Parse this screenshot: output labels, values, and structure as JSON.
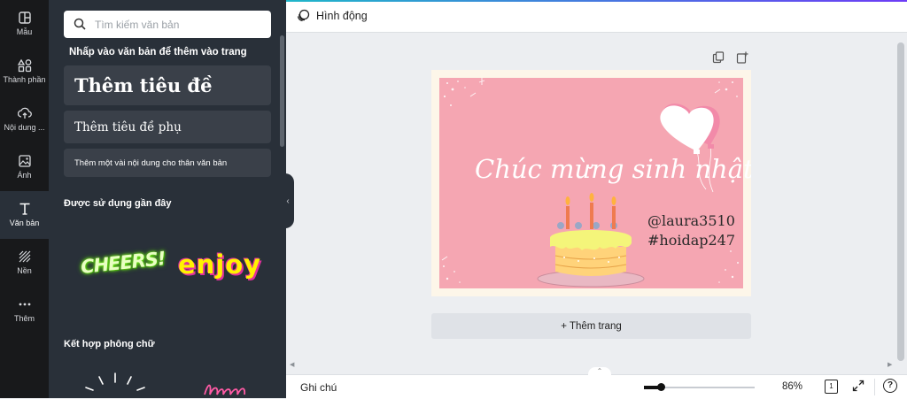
{
  "sidebar": {
    "items": [
      {
        "label": "Mẫu",
        "icon": "template-icon"
      },
      {
        "label": "Thành phần",
        "icon": "elements-icon"
      },
      {
        "label": "Nội dung ...",
        "icon": "upload-icon"
      },
      {
        "label": "Ảnh",
        "icon": "photo-icon"
      },
      {
        "label": "Văn bản",
        "icon": "text-icon"
      },
      {
        "label": "Nền",
        "icon": "background-icon"
      },
      {
        "label": "Thêm",
        "icon": "more-icon"
      }
    ],
    "active": "Văn bản"
  },
  "panel": {
    "search_placeholder": "Tìm kiếm văn bản",
    "instruction": "Nhấp vào văn bản để thêm vào trang",
    "add_heading": "Thêm tiêu đề",
    "add_subheading": "Thêm tiêu đề phụ",
    "add_body": "Thêm một vài nội dung cho thân văn bản",
    "recent_title": "Được sử dụng gần đây",
    "sticker_1": "CHEERS!",
    "sticker_2": "enjoy",
    "font_combos_title": "Kết hợp phông chữ"
  },
  "toolbar": {
    "animate_label": "Hình động"
  },
  "canvas": {
    "greeting": "Chúc mừng sinh nhật",
    "line_1": "@laura3510",
    "line_2": "#hoidap247",
    "add_page_label": "+ Thêm trang"
  },
  "footer": {
    "notes_label": "Ghi chú",
    "zoom_value": 86,
    "zoom_label": "86%",
    "page_count": "1",
    "help_label": "?"
  },
  "colors": {
    "card_pink": "#f5a6b2",
    "card_border": "#fdf6e9",
    "accent": "#7d2ae8"
  }
}
